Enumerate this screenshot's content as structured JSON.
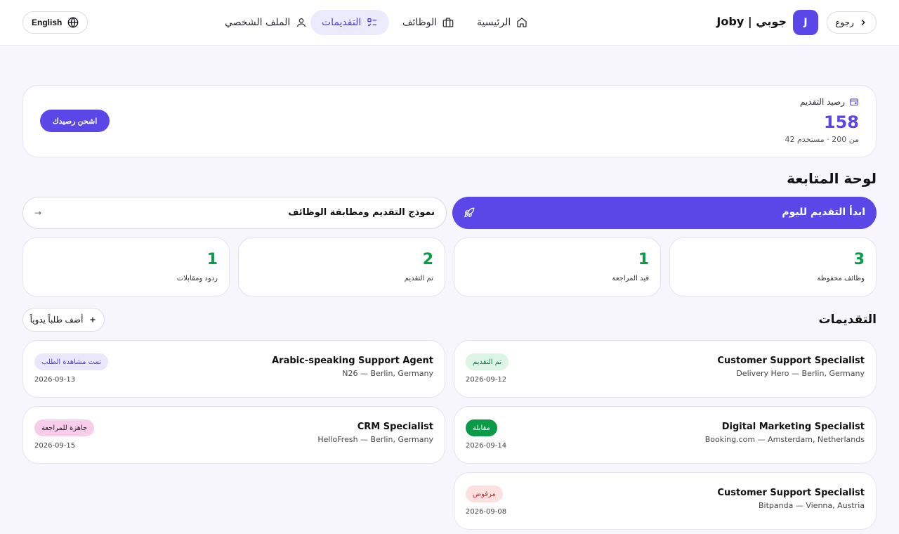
{
  "header": {
    "language_label": "English",
    "nav": {
      "profile": "الملف الشخصي",
      "applications": "التقديمات",
      "jobs": "الوظائف",
      "home": "الرئيسية"
    },
    "brand_name": "Joby | جوبي",
    "brand_logo_letter": "J",
    "back_label": "رجوع"
  },
  "balance": {
    "label": "رصيد التقديم",
    "value": "158",
    "subtext": "من 200 · مستخدم 42",
    "topup_label": "اشحن رصيدك"
  },
  "dashboard": {
    "title": "لوحة المتابعة",
    "start_today_label": "ابدأ التقديم لليوم",
    "template_label": "نموذج التقديم ومطابقة الوظائف",
    "template_arrow": "→",
    "stats": [
      {
        "value": "3",
        "label": "وظائف محفوظة"
      },
      {
        "value": "1",
        "label": "قيد المراجعة"
      },
      {
        "value": "2",
        "label": "تم التقديم"
      },
      {
        "value": "1",
        "label": "ردود ومقابلات"
      }
    ]
  },
  "applications": {
    "title": "التقديمات",
    "add_manual_label": "أضف طلباً يدوياً",
    "items": [
      {
        "title": "Customer Support Specialist",
        "company": "Delivery Hero — Berlin, Germany",
        "status": "تم التقديم",
        "date": "2026-09-12"
      },
      {
        "title": "Arabic-speaking Support Agent",
        "company": "N26 — Berlin, Germany",
        "status": "تمت مشاهدة الطلب",
        "date": "2026-09-13"
      },
      {
        "title": "Digital Marketing Specialist",
        "company": "Booking.com — Amsterdam, Netherlands",
        "status": "مقابلة",
        "date": "2026-09-14"
      },
      {
        "title": "CRM Specialist",
        "company": "HelloFresh — Berlin, Germany",
        "status": "جاهزة للمراجعة",
        "date": "2026-09-15"
      },
      {
        "title": "Customer Support Specialist",
        "company": "Bitpanda — Vienna, Austria",
        "status": "مرفوض",
        "date": "2026-09-08"
      }
    ]
  },
  "colors": {
    "accent": "#5b47e8",
    "success": "#0a9a48",
    "danger": "#d22a2a"
  }
}
